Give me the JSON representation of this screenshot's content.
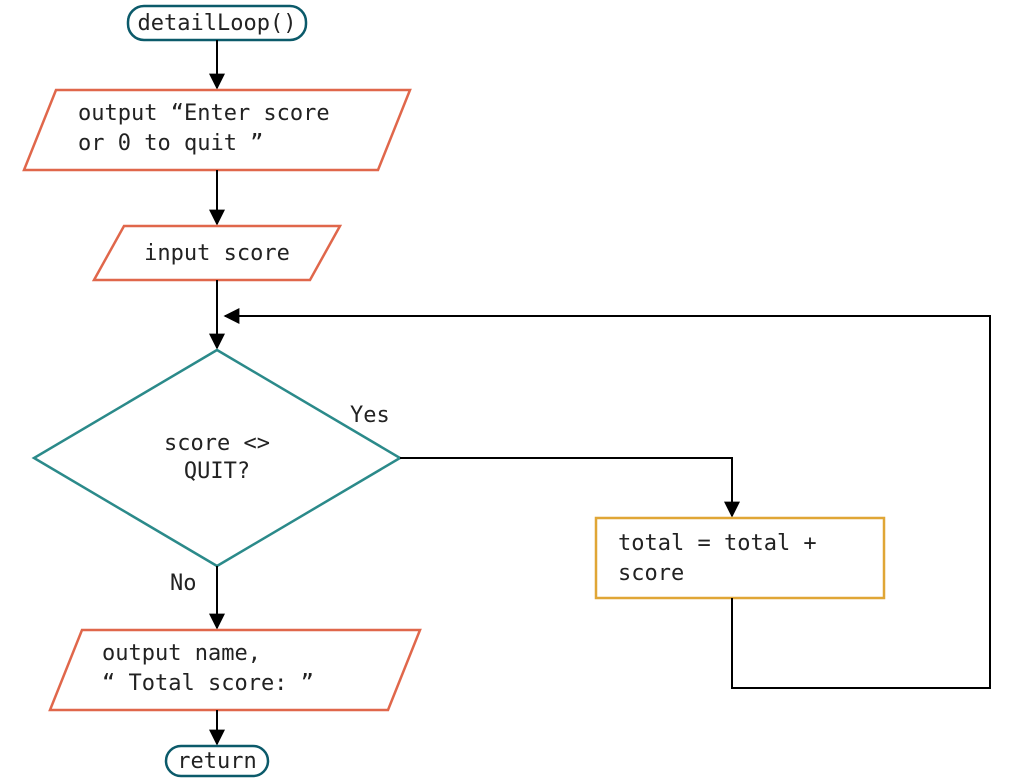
{
  "terminator_start": "detailLoop()",
  "io_prompt_line1": "output “Enter score",
  "io_prompt_line2": "or 0 to quit ”",
  "io_input": "input score",
  "decision_line1": "score <>",
  "decision_line2": "QUIT?",
  "decision_yes": "Yes",
  "decision_no": "No",
  "process_line1": "total = total +",
  "process_line2": "score",
  "io_output_line1": "output name,",
  "io_output_line2": "“ Total score: ”",
  "terminator_end": "return"
}
